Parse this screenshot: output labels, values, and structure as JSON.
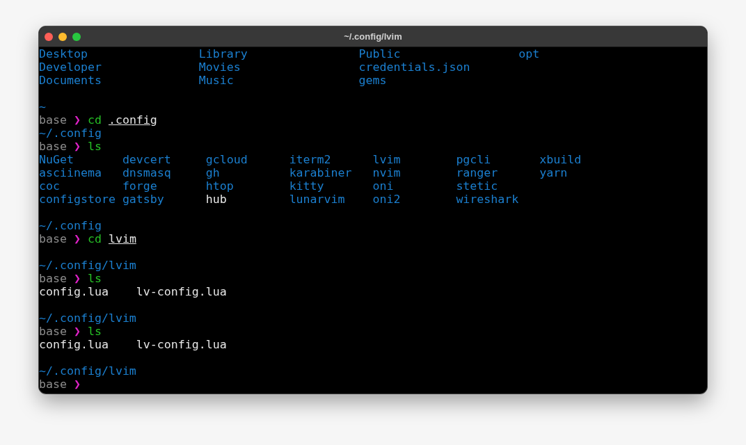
{
  "window": {
    "title": "~/.config/lvim"
  },
  "lines": [
    {
      "kind": "listing",
      "rows": [
        [
          {
            "name": "Desktop",
            "kind": "dir"
          },
          {
            "name": "Library",
            "kind": "dir"
          },
          {
            "name": "Public",
            "kind": "dir"
          },
          {
            "name": "opt",
            "kind": "dir"
          }
        ],
        [
          {
            "name": "Developer",
            "kind": "dir"
          },
          {
            "name": "Movies",
            "kind": "dir"
          },
          {
            "name": "credentials.json",
            "kind": "dir"
          }
        ],
        [
          {
            "name": "Documents",
            "kind": "dir"
          },
          {
            "name": "Music",
            "kind": "dir"
          },
          {
            "name": "gems",
            "kind": "dir"
          }
        ]
      ]
    },
    {
      "kind": "blank"
    },
    {
      "kind": "path",
      "text": "~"
    },
    {
      "kind": "prompt",
      "user": "base",
      "symbol": "❯",
      "command": "cd",
      "argument": ".config"
    },
    {
      "kind": "path",
      "text": "~/.config"
    },
    {
      "kind": "prompt",
      "user": "base",
      "symbol": "❯",
      "command": "ls"
    },
    {
      "kind": "listing",
      "rows": [
        [
          {
            "name": "NuGet",
            "kind": "dir"
          },
          {
            "name": "devcert",
            "kind": "dir"
          },
          {
            "name": "gcloud",
            "kind": "dir"
          },
          {
            "name": "iterm2",
            "kind": "dir"
          },
          {
            "name": "lvim",
            "kind": "dir"
          },
          {
            "name": "pgcli",
            "kind": "dir"
          },
          {
            "name": "xbuild",
            "kind": "dir"
          }
        ],
        [
          {
            "name": "asciinema",
            "kind": "dir"
          },
          {
            "name": "dnsmasq",
            "kind": "dir"
          },
          {
            "name": "gh",
            "kind": "dir"
          },
          {
            "name": "karabiner",
            "kind": "dir"
          },
          {
            "name": "nvim",
            "kind": "dir"
          },
          {
            "name": "ranger",
            "kind": "dir"
          },
          {
            "name": "yarn",
            "kind": "dir"
          }
        ],
        [
          {
            "name": "coc",
            "kind": "dir"
          },
          {
            "name": "forge",
            "kind": "dir"
          },
          {
            "name": "htop",
            "kind": "dir"
          },
          {
            "name": "kitty",
            "kind": "dir"
          },
          {
            "name": "oni",
            "kind": "dir"
          },
          {
            "name": "stetic",
            "kind": "dir"
          }
        ],
        [
          {
            "name": "configstore",
            "kind": "dir"
          },
          {
            "name": "gatsby",
            "kind": "dir"
          },
          {
            "name": "hub",
            "kind": "file"
          },
          {
            "name": "lunarvim",
            "kind": "dir"
          },
          {
            "name": "oni2",
            "kind": "dir"
          },
          {
            "name": "wireshark",
            "kind": "dir"
          }
        ]
      ]
    },
    {
      "kind": "blank"
    },
    {
      "kind": "path",
      "text": "~/.config"
    },
    {
      "kind": "prompt",
      "user": "base",
      "symbol": "❯",
      "command": "cd",
      "argument": "lvim"
    },
    {
      "kind": "blank"
    },
    {
      "kind": "path",
      "text": "~/.config/lvim"
    },
    {
      "kind": "prompt",
      "user": "base",
      "symbol": "❯",
      "command": "ls"
    },
    {
      "kind": "listing",
      "rows": [
        [
          {
            "name": "config.lua",
            "kind": "file"
          },
          {
            "name": "lv-config.lua",
            "kind": "file"
          }
        ]
      ]
    },
    {
      "kind": "blank"
    },
    {
      "kind": "path",
      "text": "~/.config/lvim"
    },
    {
      "kind": "prompt",
      "user": "base",
      "symbol": "❯",
      "command": "ls"
    },
    {
      "kind": "listing",
      "rows": [
        [
          {
            "name": "config.lua",
            "kind": "file"
          },
          {
            "name": "lv-config.lua",
            "kind": "file"
          }
        ]
      ]
    },
    {
      "kind": "blank"
    },
    {
      "kind": "path",
      "text": "~/.config/lvim"
    },
    {
      "kind": "prompt",
      "user": "base",
      "symbol": "❯"
    }
  ]
}
